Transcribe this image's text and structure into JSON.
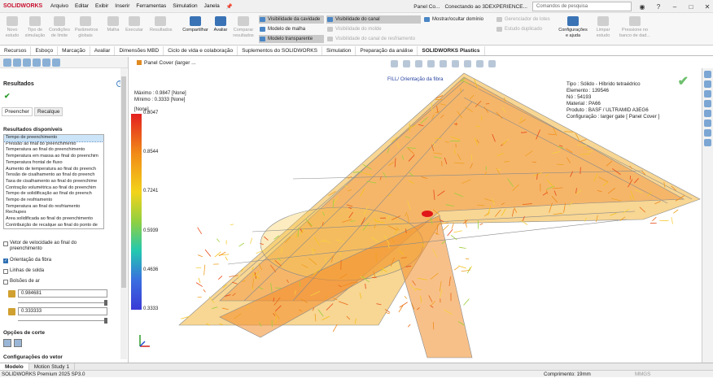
{
  "app": {
    "brand": "SOLIDWORKS",
    "menu": [
      "Arquivo",
      "Editar",
      "Exibir",
      "Inserir",
      "Ferramentas",
      "Simulation",
      "Janela"
    ],
    "doc_title": "Panel Co...",
    "connection": "Conectando ao 3DEXPERIENCE...",
    "search_placeholder": "Comandos de pesquisa"
  },
  "ribbon": {
    "buttons": [
      {
        "label": "Novo\nestudo",
        "enabled": false
      },
      {
        "label": "Tipo de\nsimulação",
        "enabled": false
      },
      {
        "label": "Condições\nde limite",
        "enabled": false
      },
      {
        "label": "Parâmetros\nglobais",
        "enabled": false
      },
      {
        "label": "Malha",
        "enabled": false
      },
      {
        "label": "Executar",
        "enabled": false
      },
      {
        "label": "Resultados",
        "enabled": false
      },
      {
        "label": "Compartilhar",
        "enabled": true
      },
      {
        "label": "Avaliar",
        "enabled": true
      },
      {
        "label": "Comparar\nresultados",
        "enabled": false
      }
    ],
    "toggles_col1": [
      "Visibilidade da cavidade",
      "Modelo de malha",
      "Modelo transparente"
    ],
    "toggles_col2": [
      "Visibilidade do canal",
      "Visibilidade do molde",
      "Visibilidade do canal de resfriamento"
    ],
    "toggle_show_domain": "Mostrar/ocultar domínio",
    "right_items": [
      "Gerenciador de lotes",
      "Estudo duplicado"
    ],
    "right_buttons": [
      {
        "label": "Configurações\ne ajuda",
        "enabled": true
      },
      {
        "label": "Limpar\nestudo",
        "enabled": false
      },
      {
        "label": "Pressione no\nbanco de dad...",
        "enabled": false
      }
    ]
  },
  "cmd_tabs": [
    "Recursos",
    "Esboço",
    "Marcação",
    "Avaliar",
    "Dimensões MBD",
    "Ciclo de vida e colaboração",
    "Suplementos do SOLIDWORKS",
    "Simulation",
    "Preparação da análise",
    "SOLIDWORKS Plastics"
  ],
  "active_cmd_tab": "SOLIDWORKS Plastics",
  "panel": {
    "title": "Resultados",
    "subtabs": [
      "Preencher",
      "Recalque"
    ],
    "available_heading": "Resultados disponíveis",
    "results": [
      "Tempo de preenchimento",
      "Pressão ao final do preenchimento",
      "Temperatura ao final do preenchimento",
      "Temperatura em massa ao final do preenchim",
      "Temperatura frontal de fluxo",
      "Aumento de temperatura ao final do preench",
      "Tensão de cisalhamento ao final do preench",
      "Taxa de cisalhamento ao final do preenchime",
      "Contração volumétrica ao final do preenchim",
      "Tempo de solidificação ao final do preench",
      "Tempo de resfriamento",
      "Temperatura ao final do resfriamento",
      "Rechupes",
      "Área solidificada ao final do preenchimento",
      "Contribuição de recalque ao final do ponto de"
    ],
    "options": [
      {
        "label": "Vetor de velocidade ao final do preenchimento",
        "checked": false
      },
      {
        "label": "Orientação da fibra",
        "checked": true
      },
      {
        "label": "Linhas de solda",
        "checked": false
      },
      {
        "label": "Bolsões de ar",
        "checked": false
      }
    ],
    "value_max": "0.984681",
    "value_min": "0.333333",
    "cut_options": "Opções de corte",
    "vector_config": "Configurações do vetor"
  },
  "viewport": {
    "breadcrumb": "Panel Cover (larger ...",
    "plot_title": "FILL/ Orientação da fibra",
    "max_label": "Máximo : 0.9847 [None]",
    "min_label": "Mínimo : 0.3333 [None]",
    "unit": "[None]",
    "info_lines": [
      "Tipo : Sólido - Híbrido tetraédrico",
      "Elemento : 139546",
      "Nó : 54193",
      "Material : PA66",
      "Produto : BASF / ULTRAMID A3EG6",
      "Configuração : larger gate [ Panel Cover ]"
    ]
  },
  "chart_data": {
    "type": "heatmap",
    "title": "FILL/ Orientação da fibra",
    "colorbar_ticks": [
      0.8047,
      0.8544,
      0.7241,
      0.5939,
      0.4636,
      0.3333
    ],
    "range": [
      0.3333,
      0.9847
    ],
    "unit": "[None]"
  },
  "bottom_tabs": [
    "Modelo",
    "Motion Study 1"
  ],
  "status": {
    "version": "SOLIDWORKS Premium 2025 SP3.0",
    "length": "Comprimento: 19mm",
    "units": "MMGS"
  }
}
